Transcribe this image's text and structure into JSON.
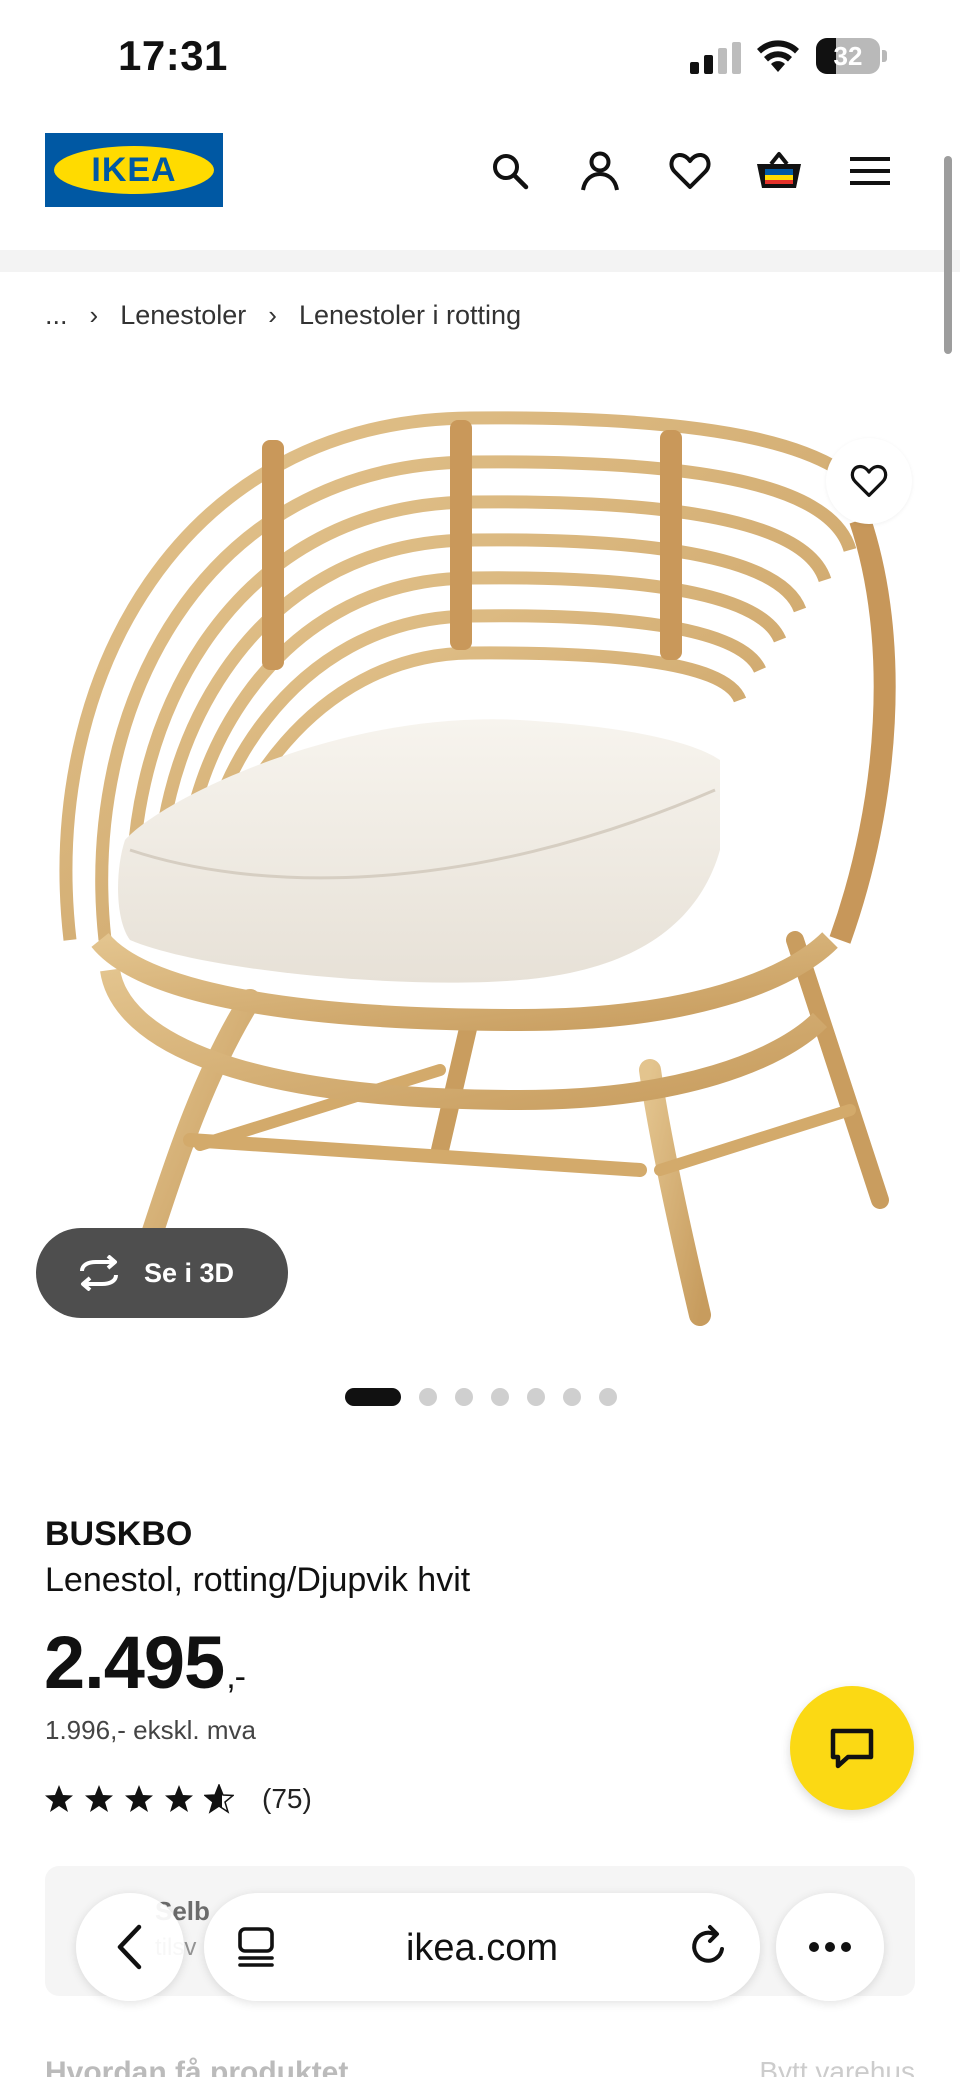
{
  "status_bar": {
    "time": "17:31",
    "battery_level": "32",
    "icons": [
      "signal-icon",
      "wifi-icon",
      "battery-icon"
    ]
  },
  "header": {
    "logo_text": "IKEA",
    "icons": [
      "search-icon",
      "account-icon",
      "heart-icon",
      "cart-icon",
      "menu-icon"
    ]
  },
  "breadcrumb": {
    "items": [
      "...",
      "Lenestoler",
      "Lenestoler i rotting"
    ]
  },
  "gallery": {
    "view3d_label": "Se i 3D",
    "total_images": 7,
    "active_index": 0
  },
  "product": {
    "name": "BUSKBO",
    "description": "Lenestol, rotting/Djupvik hvit",
    "price": "2.495",
    "price_suffix": ",-",
    "price_ex_vat": "1.996,- ekskl. mva",
    "rating_stars": 5,
    "rating_count": "(75)"
  },
  "info_card": {
    "title": "Selb",
    "subtitle": "tilsv"
  },
  "bottom": {
    "heading": "Hvordan få produktet",
    "right_link": "Bytt varehus"
  },
  "browser": {
    "url": "ikea.com"
  },
  "colors": {
    "ikea_blue": "#0058a3",
    "ikea_yellow": "#ffdb00",
    "chat_yellow": "#fbd914",
    "pill_dark": "#4e4e4e"
  }
}
